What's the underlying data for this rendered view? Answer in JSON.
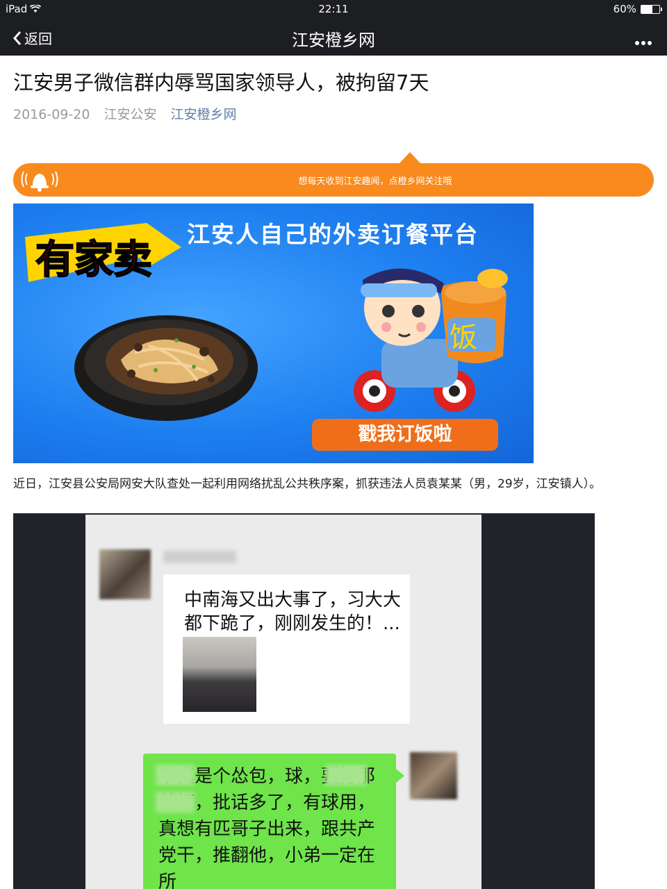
{
  "status_bar": {
    "device": "iPad",
    "time": "22:11",
    "battery": "60%",
    "battery_level": 0.6
  },
  "nav": {
    "back_label": "返回",
    "title": "江安橙乡网"
  },
  "article": {
    "title": "江安男子微信群内辱骂国家领导人，被拘留7天",
    "date": "2016-09-20",
    "author": "江安公安",
    "account": "江安橙乡网",
    "paragraph": "近日，江安县公安局网安大队查处一起利用网络扰乱公共秩序案，抓获违法人员袁某某（男，29岁，江安镇人）。"
  },
  "follow_bar": {
    "text": "想每天收到江安趣闻，点橙乡网关注哦"
  },
  "banner": {
    "logo_text": "有家卖",
    "headline": "江安人自己的外卖订餐平台",
    "box_label": "饭",
    "button": "戳我订饭啦"
  },
  "chat": {
    "message1": "中南海又出大事了，习大大都下跪了，刚刚发生的！...",
    "message2": "平真是个怂包，球，要打那就打，批话多了，有球用，真想有匹哥子出来，跟共产党干，推翻他，小弟一定在所"
  },
  "colors": {
    "nav_bg": "#1d1e22",
    "accent_orange": "#f88a1e",
    "link": "#607fa6",
    "banner_blue": "#1e7ff0",
    "wechat_green": "#6fe44b"
  }
}
